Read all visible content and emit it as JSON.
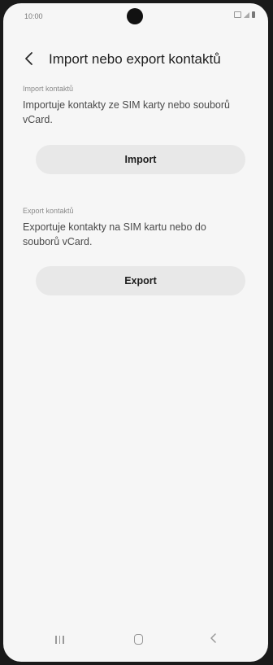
{
  "status_bar": {
    "time": "10:00"
  },
  "header": {
    "title": "Import nebo export kontaktů",
    "back_icon": "chevron-left-icon"
  },
  "import_section": {
    "label": "Import kontaktů",
    "description": "Importuje kontakty ze SIM karty nebo souborů vCard.",
    "button_label": "Import"
  },
  "export_section": {
    "label": "Export kontaktů",
    "description": "Exportuje kontakty na SIM kartu nebo do souborů vCard.",
    "button_label": "Export"
  },
  "nav_bar": {
    "recent_icon": "recent-apps-icon",
    "home_icon": "home-icon",
    "back_icon": "back-icon"
  },
  "colors": {
    "background": "#f6f6f6",
    "button_bg": "#e8e8e8",
    "title_text": "#1e1e1e",
    "body_text": "#4a4a4a",
    "label_text": "#8a8a8a"
  }
}
